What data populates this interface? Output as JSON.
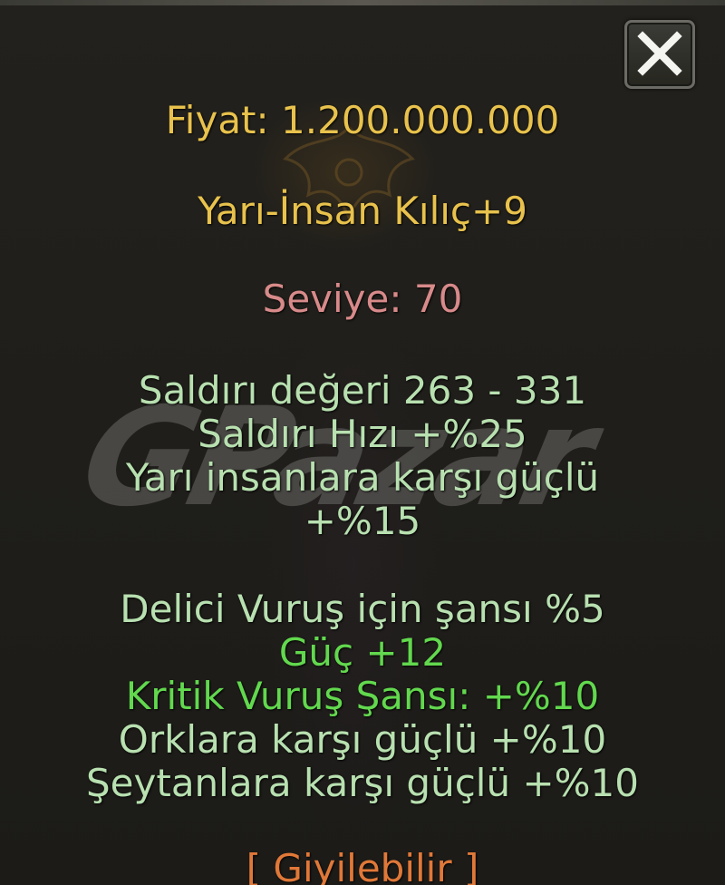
{
  "item": {
    "price": "Fiyat: 1.200.000.000",
    "name": "Yarı-İnsan Kılıç+9",
    "level": "Seviye: 70",
    "base_stats": [
      "Saldırı değeri 263 - 331",
      "Saldırı Hızı +%25",
      "Yarı insanlara karşı güçlü",
      "+%15"
    ],
    "bonuses": [
      "Delici Vuruş için şansı %5",
      "Güç +12",
      "Kritik Vuruş Şansı: +%10",
      "Orklara karşı güçlü +%10",
      "Şeytanlara karşı güçlü +%10"
    ],
    "wearable": "[ Giyilebilir ]"
  },
  "watermark": "GPazar",
  "icons": {
    "close": "close-x-icon",
    "emblem": "winged-emblem-icon"
  },
  "colors": {
    "price": "#e8c24c",
    "name": "#e8c24c",
    "level": "#d88a8a",
    "stat": "#b8e0b0",
    "bonus_highlight": "#62d84e",
    "wearable": "#e07838"
  }
}
